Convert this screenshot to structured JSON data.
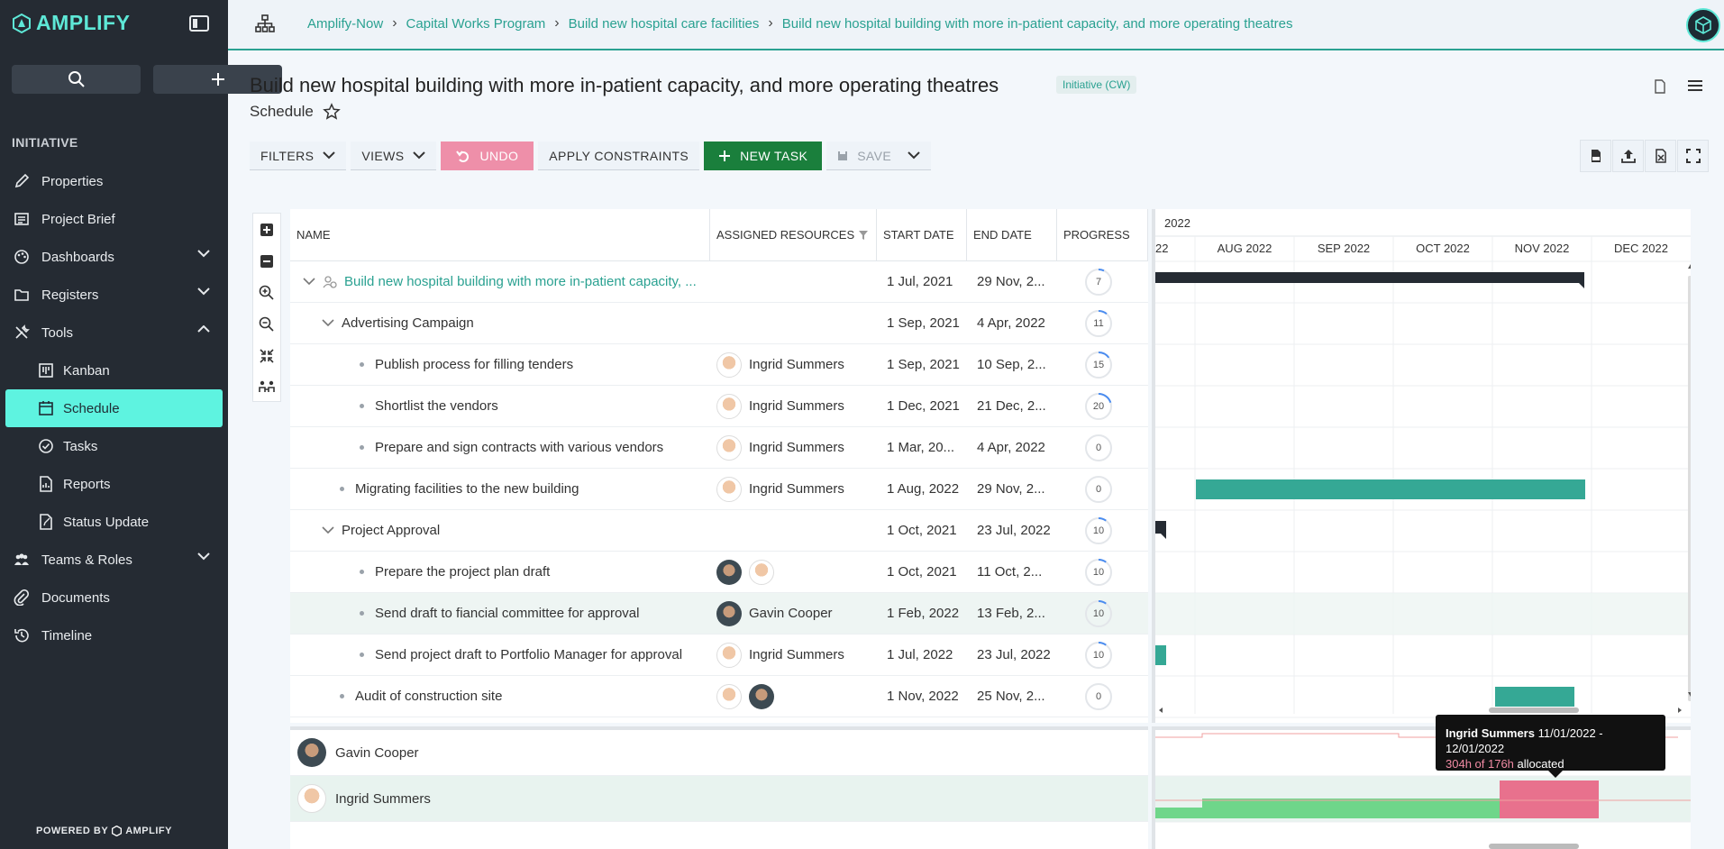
{
  "app": {
    "name": "AMPLIFY",
    "powered_by": "POWERED BY",
    "powered_brand": "AMPLIFY"
  },
  "sidebar": {
    "section": "INITIATIVE",
    "items": [
      {
        "label": "Properties",
        "icon": "pencil-icon"
      },
      {
        "label": "Project Brief",
        "icon": "list-icon"
      },
      {
        "label": "Dashboards",
        "icon": "palette-icon",
        "chevron": "down"
      },
      {
        "label": "Registers",
        "icon": "folder-icon",
        "chevron": "down"
      },
      {
        "label": "Tools",
        "icon": "tools-icon",
        "chevron": "up"
      },
      {
        "label": "Kanban",
        "icon": "kanban-icon",
        "sub": true
      },
      {
        "label": "Schedule",
        "icon": "calendar-icon",
        "sub": true,
        "active": true
      },
      {
        "label": "Tasks",
        "icon": "check-circle-icon",
        "sub": true
      },
      {
        "label": "Reports",
        "icon": "report-icon",
        "sub": true
      },
      {
        "label": "Status Update",
        "icon": "edit-doc-icon",
        "sub": true
      },
      {
        "label": "Teams & Roles",
        "icon": "people-icon",
        "chevron": "down"
      },
      {
        "label": "Documents",
        "icon": "paperclip-icon"
      },
      {
        "label": "Timeline",
        "icon": "history-icon"
      }
    ]
  },
  "breadcrumb": [
    "Amplify-Now",
    "Capital Works Program",
    "Build new hospital care facilities",
    "Build new hospital building with more in-patient capacity, and more operating theatres"
  ],
  "page": {
    "title": "Build new hospital building with more in-patient capacity, and more operating theatres",
    "tag": "Initiative (CW)",
    "subtitle": "Schedule"
  },
  "toolbar": {
    "filters": "FILTERS",
    "views": "VIEWS",
    "undo": "UNDO",
    "apply": "APPLY CONSTRAINTS",
    "new_task": "NEW TASK",
    "save": "SAVE"
  },
  "columns": {
    "name": "NAME",
    "resources": "ASSIGNED RESOURCES",
    "start": "START DATE",
    "end": "END DATE",
    "progress": "PROGRESS"
  },
  "rows": [
    {
      "name": "Build new hospital building with more in-patient capacity, ...",
      "start": "1 Jul, 2021",
      "end": "29 Nov, 2...",
      "progress": "7",
      "level": 0,
      "expander": true,
      "link": true,
      "resources": []
    },
    {
      "name": "Advertising Campaign",
      "start": "1 Sep, 2021",
      "end": "4 Apr, 2022",
      "progress": "11",
      "level": 1,
      "expander": true,
      "resources": []
    },
    {
      "name": "Publish process for filling tenders",
      "start": "1 Sep, 2021",
      "end": "10 Sep, 2...",
      "progress": "15",
      "level": 2,
      "resources": [
        "ing"
      ],
      "resource_label": "Ingrid Summers"
    },
    {
      "name": "Shortlist the vendors",
      "start": "1 Dec, 2021",
      "end": "21 Dec, 2...",
      "progress": "20",
      "level": 2,
      "resources": [
        "ing"
      ],
      "resource_label": "Ingrid Summers"
    },
    {
      "name": "Prepare and sign contracts with various vendors",
      "start": "1 Mar, 20...",
      "end": "4 Apr, 2022",
      "progress": "0",
      "level": 2,
      "resources": [
        "ing"
      ],
      "resource_label": "Ingrid Summers"
    },
    {
      "name": "Migrating facilities to the new building",
      "start": "1 Aug, 2022",
      "end": "29 Nov, 2...",
      "progress": "0",
      "level": 1,
      "resources": [
        "ing"
      ],
      "resource_label": "Ingrid Summers"
    },
    {
      "name": "Project Approval",
      "start": "1 Oct, 2021",
      "end": "23 Jul, 2022",
      "progress": "10",
      "level": 1,
      "expander": true,
      "resources": []
    },
    {
      "name": "Prepare the project plan draft",
      "start": "1 Oct, 2021",
      "end": "11 Oct, 2...",
      "progress": "10",
      "level": 2,
      "resources": [
        "gav",
        "ing"
      ],
      "resource_label": ""
    },
    {
      "name": "Send draft to fiancial committee for approval",
      "start": "1 Feb, 2022",
      "end": "13 Feb, 2...",
      "progress": "10",
      "level": 2,
      "resources": [
        "gav"
      ],
      "resource_label": "Gavin Cooper",
      "highlight": true
    },
    {
      "name": "Send project draft to Portfolio Manager for approval",
      "start": "1 Jul, 2022",
      "end": "23 Jul, 2022",
      "progress": "10",
      "level": 2,
      "resources": [
        "ing"
      ],
      "resource_label": "Ingrid Summers"
    },
    {
      "name": "Audit of construction site",
      "start": "1 Nov, 2022",
      "end": "25 Nov, 2...",
      "progress": "0",
      "level": 1,
      "resources": [
        "ing",
        "gav"
      ],
      "resource_label": ""
    }
  ],
  "timeline": {
    "year": "2022",
    "months": [
      "22",
      "AUG 2022",
      "SEP 2022",
      "OCT 2022",
      "NOV 2022",
      "DEC 2022"
    ]
  },
  "resources": [
    {
      "name": "Gavin Cooper",
      "avatar": "gav"
    },
    {
      "name": "Ingrid Summers",
      "avatar": "ing",
      "highlight": true
    }
  ],
  "tooltip": {
    "name": "Ingrid Summers",
    "range": "11/01/2022 - 12/01/2022",
    "hours": "304h of 176h",
    "suffix": "allocated"
  },
  "colors": {
    "accent": "#2aa191",
    "sidebar": "#252b33",
    "active": "#5ef3e0",
    "bar": "#35a895",
    "summary": "#252b33",
    "overalloc": "#e8718d",
    "alloc": "#6fd68a"
  }
}
